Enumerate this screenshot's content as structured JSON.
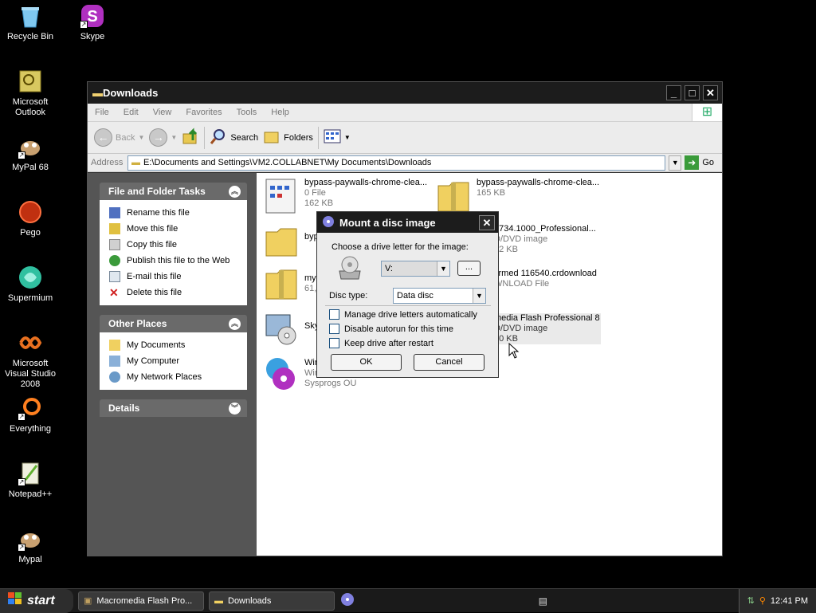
{
  "desktop": {
    "icons": [
      {
        "label": "Recycle Bin"
      },
      {
        "label": "Skype"
      },
      {
        "label": "Microsoft Outlook"
      },
      {
        "label": "MyPal 68"
      },
      {
        "label": "Pego"
      },
      {
        "label": "Supermium"
      },
      {
        "label": "Microsoft Visual Studio 2008"
      },
      {
        "label": "Everything"
      },
      {
        "label": "Notepad++"
      },
      {
        "label": "Mypal"
      }
    ]
  },
  "window": {
    "title": "Downloads",
    "menu": [
      "File",
      "Edit",
      "View",
      "Favorites",
      "Tools",
      "Help"
    ],
    "toolbar": {
      "back": "Back",
      "search": "Search",
      "folders": "Folders"
    },
    "address": {
      "label": "Address",
      "value": "E:\\Documents and Settings\\VM2.COLLABNET\\My Documents\\Downloads",
      "go": "Go"
    }
  },
  "tasks": {
    "title": "File and Folder Tasks",
    "items": [
      "Rename this file",
      "Move this file",
      "Copy this file",
      "Publish this file to the Web",
      "E-mail this file",
      "Delete this file"
    ]
  },
  "places": {
    "title": "Other Places",
    "items": [
      "My Documents",
      "My Computer",
      "My Network Places"
    ]
  },
  "details": {
    "title": "Details"
  },
  "files": [
    {
      "name": "bypass-paywalls-chrome-clea...",
      "line2": "0 File",
      "line3": "162 KB"
    },
    {
      "name": "bypass-paywalls-chrome-clea...",
      "line2": "165 KB",
      "line3": ""
    },
    {
      "name": "byp",
      "line2": "",
      "line3": ""
    },
    {
      "name": "4734.1000_Professional...",
      "line2": "D/DVD image",
      "line3": "52 KB"
    },
    {
      "name": "myp",
      "line2": "61,",
      "line3": ""
    },
    {
      "name": "firmed 116540.crdownload",
      "line2": "WNLOAD File",
      "line3": ""
    },
    {
      "name": "Sky",
      "line2": "",
      "line3": ""
    },
    {
      "name": "media Flash Professional 8",
      "line2": "D/DVD image",
      "line3": "30 KB"
    },
    {
      "name": "Win",
      "line2": "Win",
      "line3": "Sysprogs OU"
    }
  ],
  "dialog": {
    "title": "Mount a disc image",
    "prompt": "Choose a drive letter for the image:",
    "drive": "V:",
    "browse": "...",
    "disc_type_label": "Disc type:",
    "disc_type": "Data disc",
    "checks": [
      "Manage drive letters automatically",
      "Disable autorun for this time",
      "Keep drive after restart"
    ],
    "ok": "OK",
    "cancel": "Cancel"
  },
  "taskbar": {
    "start": "start",
    "tasks": [
      "Macromedia Flash Pro...",
      "Downloads"
    ],
    "clock": "12:41 PM"
  }
}
